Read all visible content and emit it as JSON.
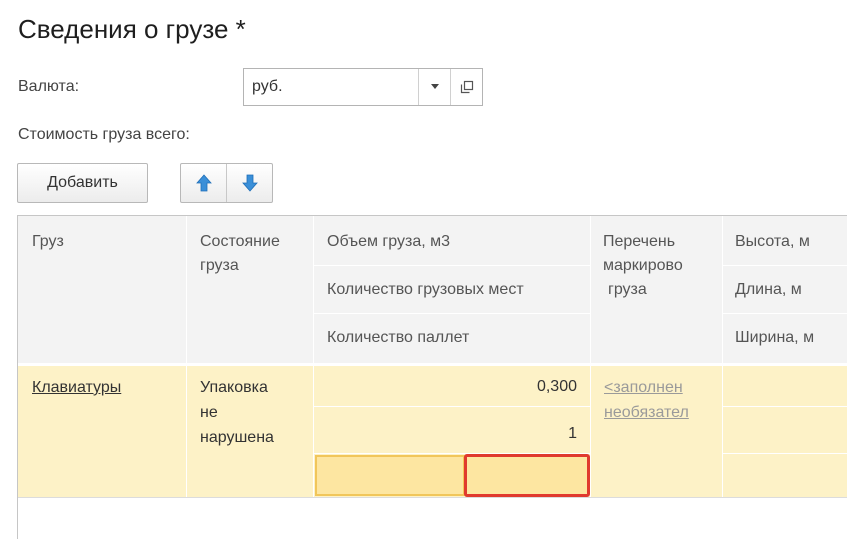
{
  "form": {
    "title": "Сведения о грузе *"
  },
  "currency": {
    "label": "Валюта:",
    "value": "руб."
  },
  "total_cost": {
    "label": "Стоимость груза всего:"
  },
  "toolbar": {
    "add_label": "Добавить"
  },
  "table": {
    "headers": {
      "cargo": "Груз",
      "state": "Состояние груза",
      "volume": "Объем груза, м3",
      "places": "Количество грузовых мест",
      "pallets": "Количество паллет",
      "marking_line1": "Перечень",
      "marking_line2": "маркирово",
      "marking_line3": "груза",
      "height": "Высота, м",
      "length": "Длина, м",
      "width": "Ширина, м"
    },
    "rows": [
      {
        "cargo": "Клавиатуры",
        "state_line1": "Упаковка",
        "state_line2": "не",
        "state_line3": "нарушена",
        "volume": "0,300",
        "places": "1",
        "pallets": "",
        "marking_line1": "<заполнен",
        "marking_line2": "необязател"
      }
    ]
  },
  "colors": {
    "row_bg": "#fdf2c7",
    "selected_cell": "#fde6a1",
    "selected_border": "#e03a2e",
    "header_bg": "#f3f3f3"
  }
}
